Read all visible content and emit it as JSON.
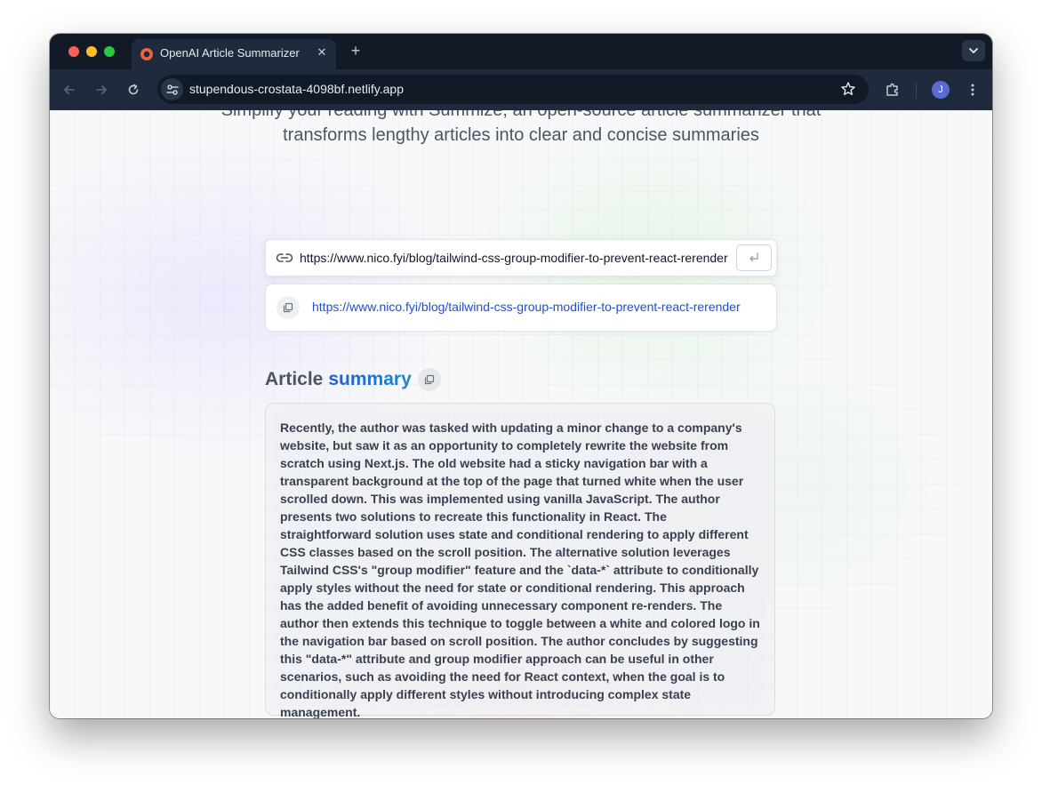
{
  "browser": {
    "tab_title": "OpenAI Article Summarizer",
    "tab_close": "✕",
    "new_tab": "+",
    "address": "stupendous-crostata-4098bf.netlify.app",
    "avatar_initial": "J"
  },
  "page": {
    "subtitle_line1": "Simplify your reading with Summize, an open-source article summarizer that",
    "subtitle_line2": "transforms lengthy articles into clear and concise summaries",
    "url_input_value": "https://www.nico.fyi/blog/tailwind-css-group-modifier-to-prevent-react-rerender",
    "submit_glyph": "↵",
    "history_link": "https://www.nico.fyi/blog/tailwind-css-group-modifier-to-prevent-react-rerender",
    "heading_prefix": "Article",
    "heading_accent": "summary",
    "summary": "Recently, the author was tasked with updating a minor change to a company's website, but saw it as an opportunity to completely rewrite the website from scratch using Next.js. The old website had a sticky navigation bar with a transparent background at the top of the page that turned white when the user scrolled down. This was implemented using vanilla JavaScript. The author presents two solutions to recreate this functionality in React. The straightforward solution uses state and conditional rendering to apply different CSS classes based on the scroll position. The alternative solution leverages Tailwind CSS's \"group modifier\" feature and the `data-*` attribute to conditionally apply styles without the need for state or conditional rendering. This approach has the added benefit of avoiding unnecessary component re-renders. The author then extends this technique to toggle between a white and colored logo in the navigation bar based on scroll position. The author concludes by suggesting this \"data-*\" attribute and group modifier approach can be useful in other scenarios, such as avoiding the need for React context, when the goal is to conditionally apply different styles without introducing complex state management."
  },
  "colors": {
    "accent_blue": "#1d5fd6",
    "link_blue": "#1d4ed8",
    "browser_dark": "#121a28",
    "browser_toolbar": "#1f2a3c"
  },
  "icons": {
    "back": "arrow-left-icon",
    "forward": "arrow-right-icon",
    "reload": "reload-icon",
    "site_info": "tune-icon",
    "bookmark": "star-icon",
    "extensions": "puzzle-icon",
    "menu": "kebab-menu-icon",
    "link": "link-icon",
    "copy": "copy-icon",
    "submit": "enter-icon"
  }
}
